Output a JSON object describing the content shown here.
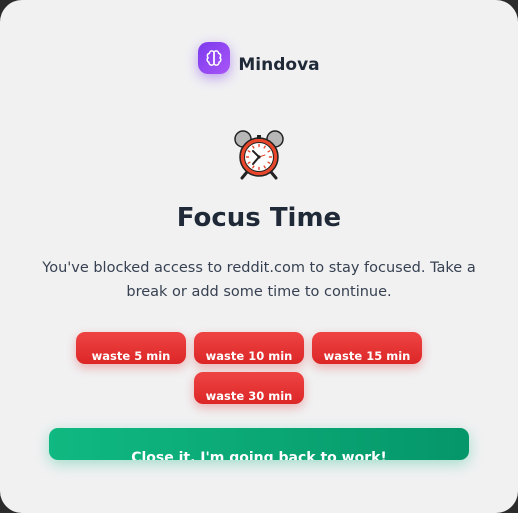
{
  "brand": {
    "name": "Mindova",
    "logo_icon": "brain-icon",
    "logo_color": "#7c3aed"
  },
  "hero_icon": "alarm-clock-icon",
  "title": "Focus Time",
  "message": "You've blocked access to reddit.com to stay focused. Take a break or add some time to continue.",
  "waste_buttons": [
    {
      "label": "waste 5 min"
    },
    {
      "label": "waste 10 min"
    },
    {
      "label": "waste 15 min"
    },
    {
      "label": "waste 30 min"
    }
  ],
  "close_button": {
    "label": "Close it, I'm going back to work!"
  },
  "colors": {
    "danger": "#ef4444",
    "success": "#10b981",
    "text": "#1f2937",
    "background": "#f1f1f2"
  }
}
